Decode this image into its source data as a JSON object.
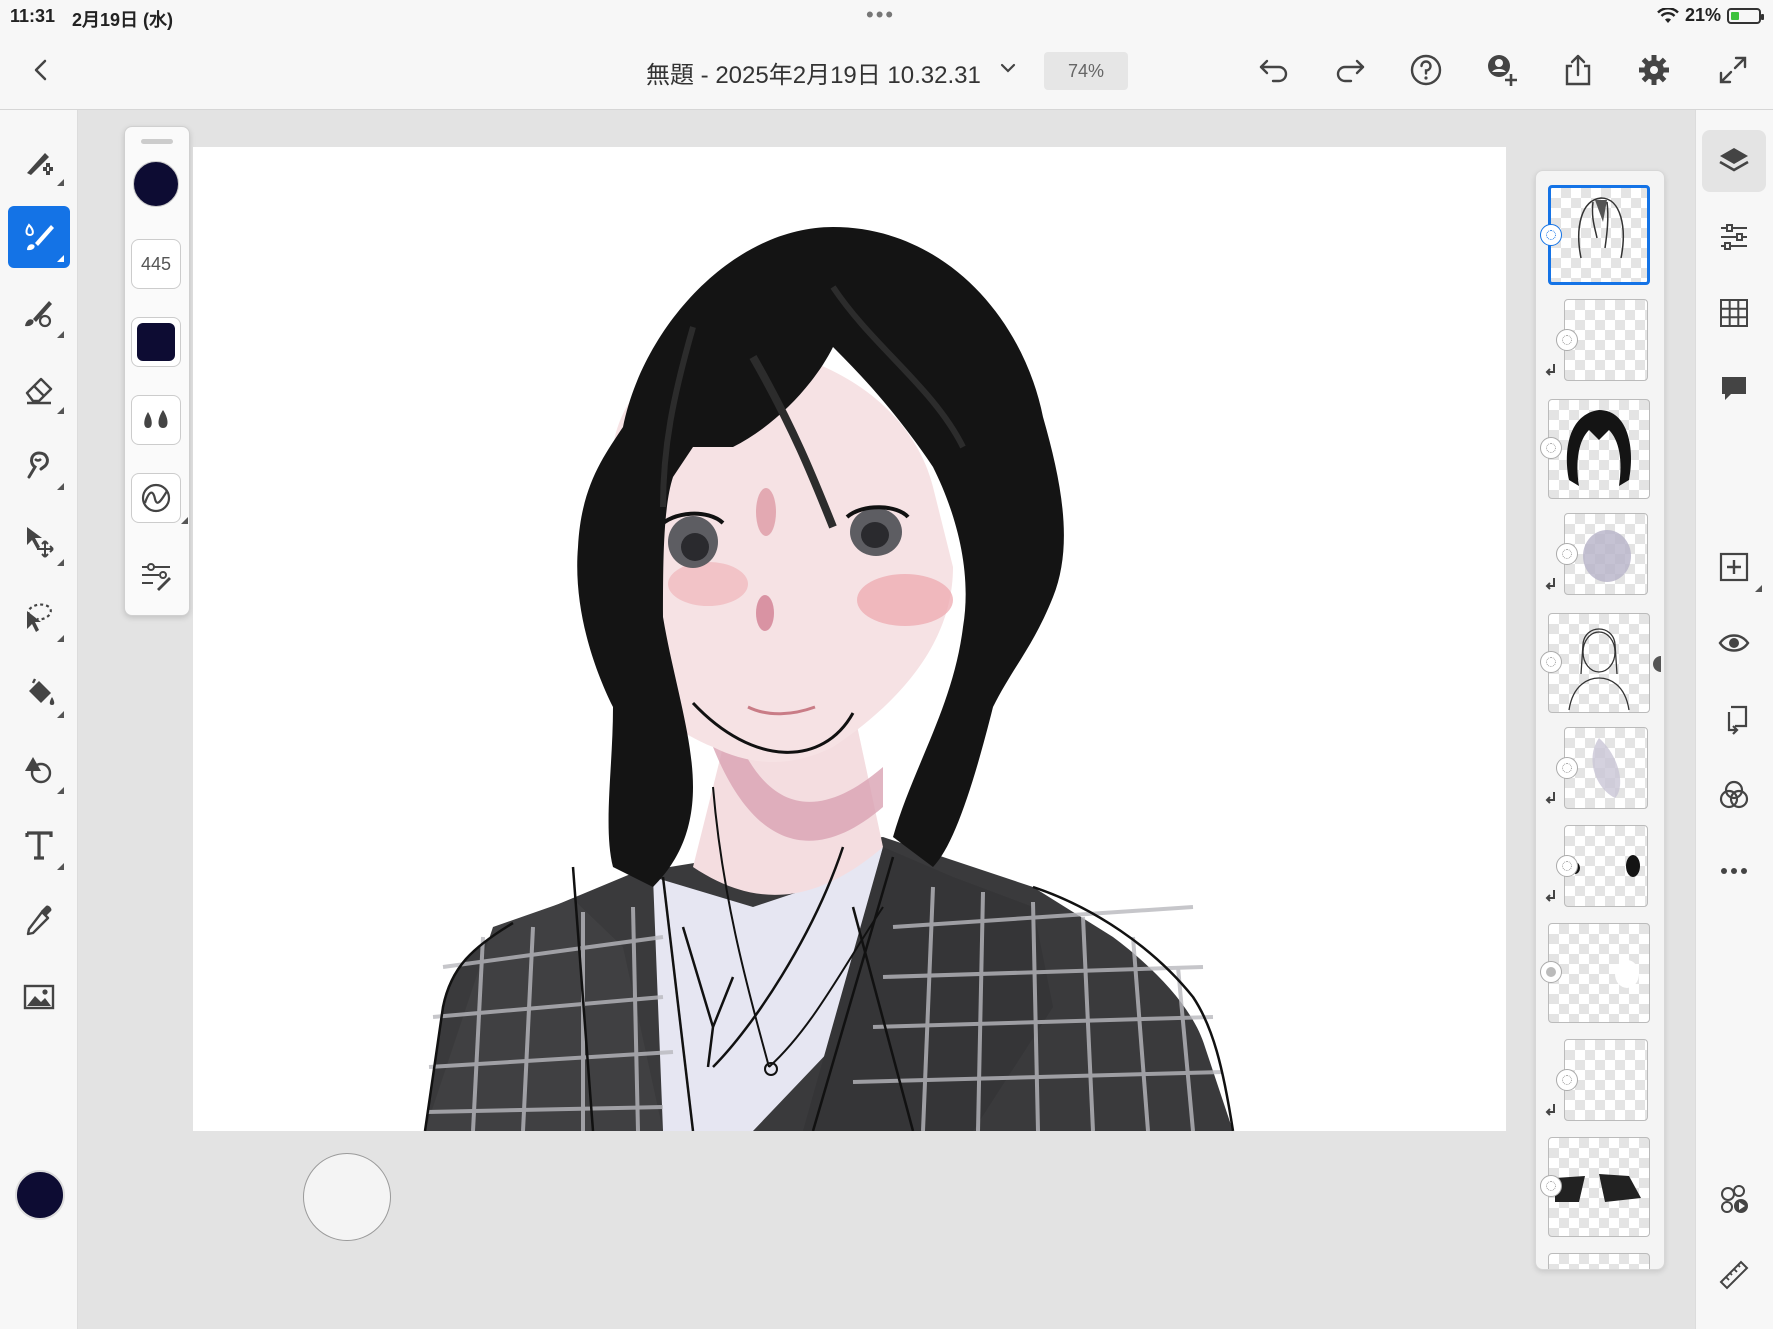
{
  "status_bar": {
    "time": "11:31",
    "date": "2月19日 (水)",
    "battery": "21%"
  },
  "header": {
    "document_title": "無題 - 2025年2月19日 10.32.31",
    "zoom": "74%"
  },
  "brush_props": {
    "size": "445",
    "color": "#0d0c33"
  },
  "colors": {
    "accent": "#1473e6",
    "current_color": "#0d0c33"
  }
}
